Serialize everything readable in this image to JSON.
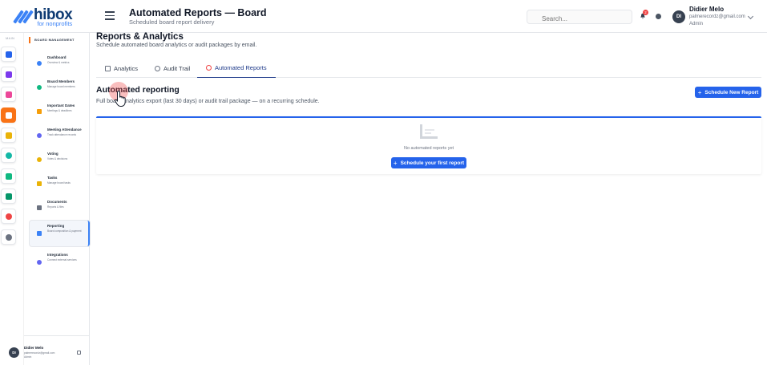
{
  "app": {
    "logo_text": "hibox",
    "logo_subtext": "for nonprofits",
    "header_title": "Automated Reports — Board",
    "header_subtitle": "Scheduled board report delivery"
  },
  "header": {
    "search_placeholder": "Search...",
    "notification_count": "2",
    "user_initials": "DI",
    "user_name": "Didier Melo",
    "user_email": "palmerecordz@gmail.com",
    "user_role": "Admin"
  },
  "rail": {
    "label": "MAIN",
    "items": [
      {
        "icon": "home-icon",
        "color": "#2563eb"
      },
      {
        "icon": "org-chart-icon",
        "color": "#7c3aed"
      },
      {
        "icon": "pill-icon",
        "color": "#ec4899"
      },
      {
        "icon": "board-icon",
        "color": "#ffffff"
      },
      {
        "icon": "stack-icon",
        "color": "#eab308"
      },
      {
        "icon": "circle-icon",
        "color": "#14b8a6"
      },
      {
        "icon": "network-icon",
        "color": "#10b981"
      },
      {
        "icon": "people-icon",
        "color": "#059669"
      },
      {
        "icon": "pie-chart-icon",
        "color": "#ef4444"
      },
      {
        "icon": "gear-icon",
        "color": "#6b7280"
      }
    ]
  },
  "sidebar": {
    "section_title": "BOARD MANAGEMENT",
    "items": [
      {
        "title": "Dashboard",
        "desc": "Overview & metrics",
        "color": "#3b82f6"
      },
      {
        "title": "Board Members",
        "desc": "Manage board members",
        "color": "#10b981"
      },
      {
        "title": "Important Dates",
        "desc": "Meetings & deadlines",
        "color": "#f59e0b"
      },
      {
        "title": "Meeting Attendance",
        "desc": "Track attendance records",
        "color": "#6366f1"
      },
      {
        "title": "Voting",
        "desc": "Votes & decisions",
        "color": "#eab308"
      },
      {
        "title": "Tasks",
        "desc": "Manage board tasks",
        "color": "#eab308"
      },
      {
        "title": "Documents",
        "desc": "Reports & files",
        "color": "#6b7280"
      },
      {
        "title": "Reporting",
        "desc": "Board composition & payment",
        "color": "#3b82f6"
      },
      {
        "title": "Integrations",
        "desc": "Connect external services",
        "color": "#6366f1"
      }
    ],
    "footer": {
      "initials": "DI",
      "name": "Didier Melo",
      "email": "palmerecordz@gmail.com",
      "role": "Admin"
    }
  },
  "main": {
    "title": "Reports & Analytics",
    "subtitle": "Schedule automated board analytics or audit packages by email.",
    "tabs": [
      {
        "label": "Analytics"
      },
      {
        "label": "Audit Trail"
      },
      {
        "label": "Automated Reports"
      }
    ],
    "section_title": "Automated reporting",
    "section_subtitle": "Full board analytics export (last 30 days) or audit trail package — on a recurring schedule.",
    "new_report_button": "Schedule New Report",
    "empty_text": "No automated reports yet",
    "empty_button": "Schedule your first report"
  }
}
